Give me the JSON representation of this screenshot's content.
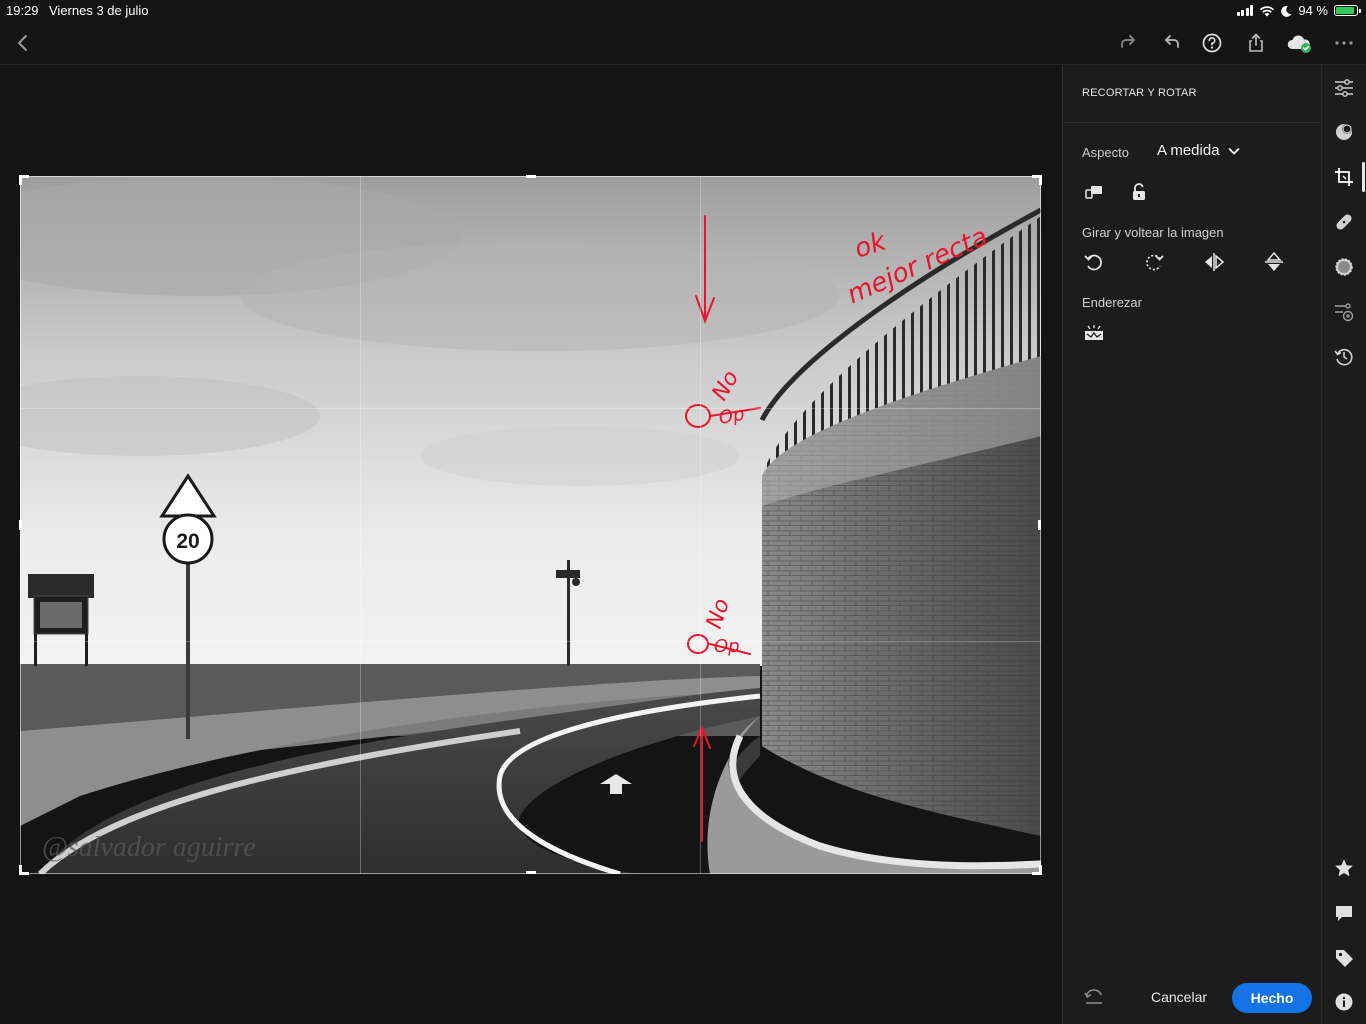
{
  "status_bar": {
    "time": "19:29",
    "date": "Viernes 3 de julio",
    "battery_text": "94 %",
    "battery_level": 0.94
  },
  "toolbar": {
    "icons": [
      "back-icon",
      "redo-icon",
      "undo-icon",
      "help-icon",
      "share-icon",
      "cloud-sync-icon",
      "more-icon"
    ]
  },
  "photo": {
    "sign_speed": "20",
    "watermark": "@salvador aguirre",
    "annotations": [
      "ok",
      "mejor recta",
      "No",
      "No",
      "Op",
      "Op"
    ]
  },
  "panel": {
    "title": "RECORTAR Y ROTAR",
    "aspect_label": "Aspecto",
    "aspect_value": "A medida",
    "rotate_label": "Girar y voltear la imagen",
    "straighten_label": "Enderezar",
    "cancel_label": "Cancelar",
    "done_label": "Hecho"
  },
  "colors": {
    "accent": "#1473e6",
    "annotation": "#e8152b",
    "battery": "#34c759"
  }
}
